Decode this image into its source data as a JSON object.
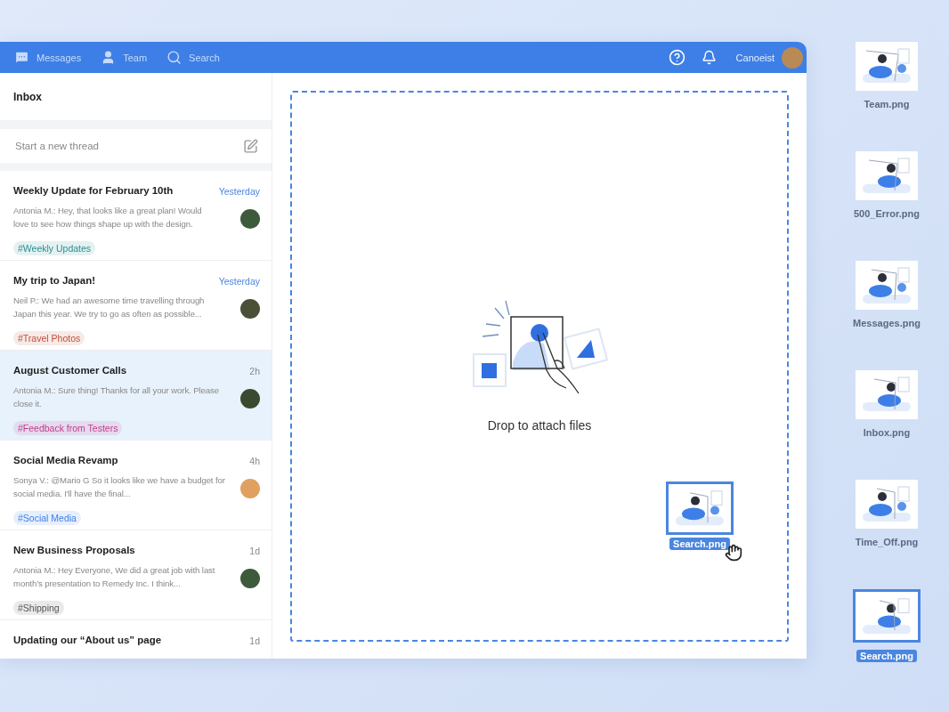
{
  "header": {
    "nav": [
      {
        "kind": "messages",
        "label": "Messages"
      },
      {
        "kind": "team",
        "label": "Team"
      },
      {
        "kind": "search",
        "label": "Search"
      }
    ],
    "user": {
      "name": "Canoeist"
    }
  },
  "sidebar": {
    "title": "Inbox",
    "new_thread": {
      "placeholder": "Start a new thread"
    },
    "threads": [
      {
        "title": "Weekly Update for February 10th",
        "time": "Yesterday",
        "recent": true,
        "selected": false,
        "preview": "Antonia M.: Hey, that looks like a great plan! Would love to see how things shape up with the design.",
        "tag": {
          "label": "#Weekly Updates",
          "color": "#2a8f8f"
        }
      },
      {
        "title": "My trip to Japan!",
        "time": "Yesterday",
        "recent": true,
        "selected": false,
        "preview": "Neil P.: We had an awesome time travelling through Japan this year. We try to go as often as possible...",
        "tag": {
          "label": "#Travel Photos",
          "color": "#c0503a"
        }
      },
      {
        "title": "August Customer Calls",
        "time": "2h",
        "recent": false,
        "selected": true,
        "preview": "Antonia M.: Sure thing! Thanks for all your work. Please close it.",
        "tag": {
          "label": "#Feedback from Testers",
          "color": "#c53b8f"
        }
      },
      {
        "title": "Social Media Revamp",
        "time": "4h",
        "recent": false,
        "selected": false,
        "preview": "Sonya V.: @Mario G So it looks like we have a budget for social media. I'll have the final...",
        "tag": {
          "label": "#Social Media",
          "color": "#3d7fe6"
        }
      },
      {
        "title": "New Business Proposals",
        "time": "1d",
        "recent": false,
        "selected": false,
        "preview": "Antonia M.: Hey Everyone, We did a great job with last month’s presentation to Remedy Inc. I think...",
        "tag": {
          "label": "#Shipping",
          "color": "#555555"
        }
      },
      {
        "title": "Updating our “About us” page",
        "time": "1d",
        "recent": false,
        "selected": false
      }
    ]
  },
  "dropzone": {
    "message": "Drop to attach files",
    "dragged_file": {
      "name": "Search.png"
    }
  },
  "desktop": {
    "files": [
      {
        "name": "Team.png",
        "selected": false
      },
      {
        "name": "500_Error.png",
        "selected": false
      },
      {
        "name": "Messages.png",
        "selected": false
      },
      {
        "name": "Inbox.png",
        "selected": false
      },
      {
        "name": "Time_Off.png",
        "selected": false
      },
      {
        "name": "Search.png",
        "selected": true
      }
    ]
  }
}
